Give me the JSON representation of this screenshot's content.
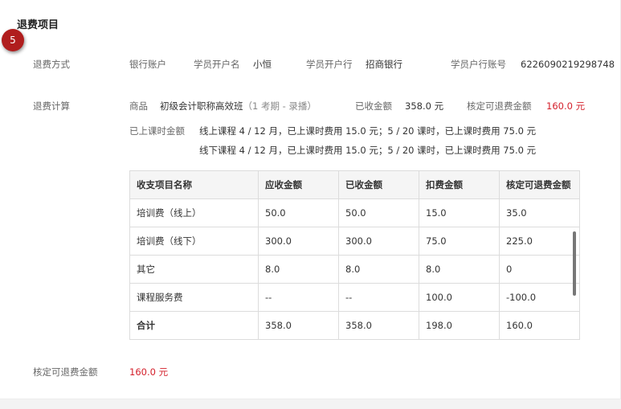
{
  "section": {
    "title": "退费项目",
    "step_number": "5"
  },
  "refund_method": {
    "label": "退费方式",
    "method": "银行账户",
    "holder_label": "学员开户名",
    "holder_value": "小恒",
    "bank_label": "学员开户行",
    "bank_value": "招商银行",
    "account_label": "学员户行账号",
    "account_value": "6226090219298748"
  },
  "refund_calc": {
    "label": "退费计算",
    "product_label": "商品",
    "product_name": "初级会计职称高效班",
    "product_detail": "（1 考期 - 录播）",
    "received_label": "已收金额",
    "received_value": "358.0 元",
    "approved_label": "核定可退费金额",
    "approved_value": "160.0 元",
    "attended_label": "已上课时金额",
    "online_line": "线上课程  4 / 12 月，已上课时费用 15.0 元；5 / 20 课时，已上课时费用 75.0 元",
    "offline_line": "线下课程  4 / 12 月，已上课时费用 15.0 元；5 / 20 课时，已上课时费用 75.0 元"
  },
  "fee_table": {
    "headers": [
      "收支项目名称",
      "应收金额",
      "已收金额",
      "扣费金额",
      "核定可退费金额"
    ],
    "rows": [
      [
        "培训费（线上）",
        "50.0",
        "50.0",
        "15.0",
        "35.0"
      ],
      [
        "培训费（线下）",
        "300.0",
        "300.0",
        "75.0",
        "225.0"
      ],
      [
        "其它",
        "8.0",
        "8.0",
        "8.0",
        "0"
      ],
      [
        "课程服务费",
        "--",
        "--",
        "100.0",
        "-100.0"
      ],
      [
        "合计",
        "358.0",
        "358.0",
        "198.0",
        "160.0"
      ]
    ]
  },
  "summary": {
    "label": "核定可退费金额",
    "value": "160.0 元"
  },
  "colors": {
    "accent_red": "#d4202b",
    "badge": "#b01d1d"
  }
}
